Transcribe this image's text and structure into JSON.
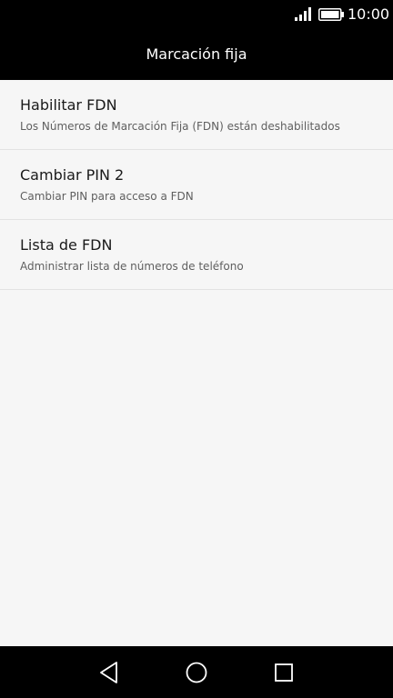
{
  "status_bar": {
    "time": "10:00",
    "signal_icon": "signal-bars-icon",
    "battery_icon": "battery-full-icon"
  },
  "app_bar": {
    "title": "Marcación fija"
  },
  "settings": {
    "items": [
      {
        "title": "Habilitar FDN",
        "subtitle": "Los Números de Marcación Fija (FDN) están deshabilitados"
      },
      {
        "title": "Cambiar PIN 2",
        "subtitle": "Cambiar PIN para acceso a FDN"
      },
      {
        "title": "Lista de FDN",
        "subtitle": "Administrar lista de números de teléfono"
      }
    ]
  },
  "nav_bar": {
    "back_icon": "back-triangle-icon",
    "home_icon": "home-circle-icon",
    "recents_icon": "recents-square-icon"
  },
  "colors": {
    "bars": "#000000",
    "background": "#f6f6f6",
    "divider": "#e2e2e2",
    "title_text": "#1a1a1a",
    "subtitle_text": "#5f5f5f"
  }
}
